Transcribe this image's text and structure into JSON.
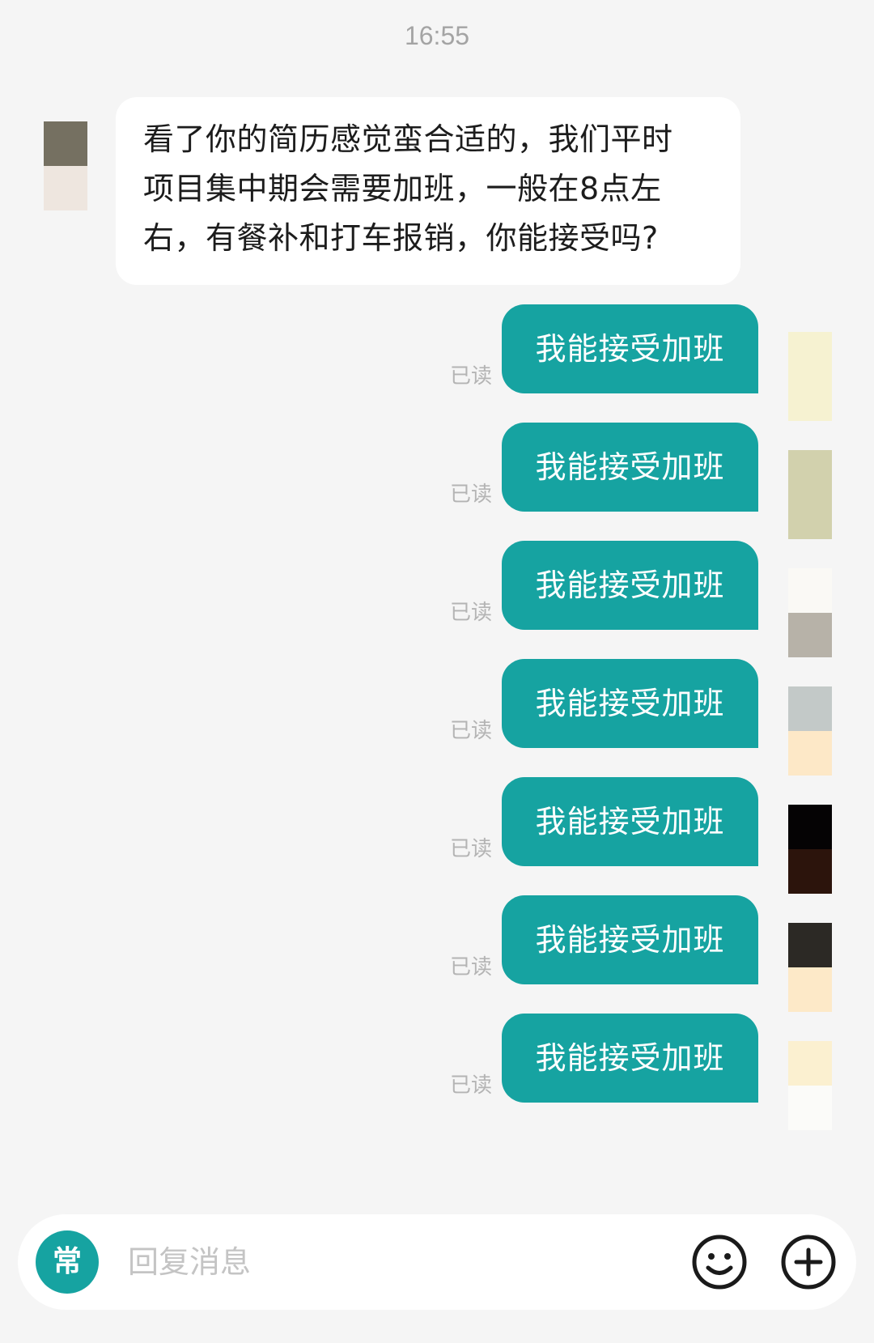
{
  "header": {
    "timestamp": "16:55"
  },
  "incoming": {
    "lines": [
      "看了你的简历感觉蛮合适的，我们平时",
      "项目集中期会需要加班，一般在8点左",
      "右，有餐补和打车报销，你能接受吗?"
    ],
    "avatar_colors": [
      "#757061",
      "#eee6df"
    ]
  },
  "outgoing": [
    {
      "text": "我能接受加班",
      "status": "已读",
      "avatar_colors": [
        "#f6f2d1",
        "#f6f2d1"
      ]
    },
    {
      "text": "我能接受加班",
      "status": "已读",
      "avatar_colors": [
        "#d2d1ad",
        "#d2d1ad"
      ]
    },
    {
      "text": "我能接受加班",
      "status": "已读",
      "avatar_colors": [
        "#faf9f5",
        "#b7b2a8"
      ]
    },
    {
      "text": "我能接受加班",
      "status": "已读",
      "avatar_colors": [
        "#c3c9c8",
        "#fde8c7"
      ]
    },
    {
      "text": "我能接受加班",
      "status": "已读",
      "avatar_colors": [
        "#050304",
        "#2c140c"
      ]
    },
    {
      "text": "我能接受加班",
      "status": "已读",
      "avatar_colors": [
        "#2c2925",
        "#fde9c8"
      ]
    },
    {
      "text": "我能接受加班",
      "status": "已读",
      "avatar_colors": [
        "#fbf0d0",
        "#fbfbf9"
      ]
    }
  ],
  "input_bar": {
    "common_label": "常",
    "placeholder": "回复消息",
    "emoji_icon": "smiley-icon",
    "plus_icon": "plus-circle-icon"
  },
  "colors": {
    "accent": "#16a3a1",
    "background": "#f5f5f5",
    "incoming_bubble": "#ffffff",
    "read_status": "#b4b4b4"
  }
}
